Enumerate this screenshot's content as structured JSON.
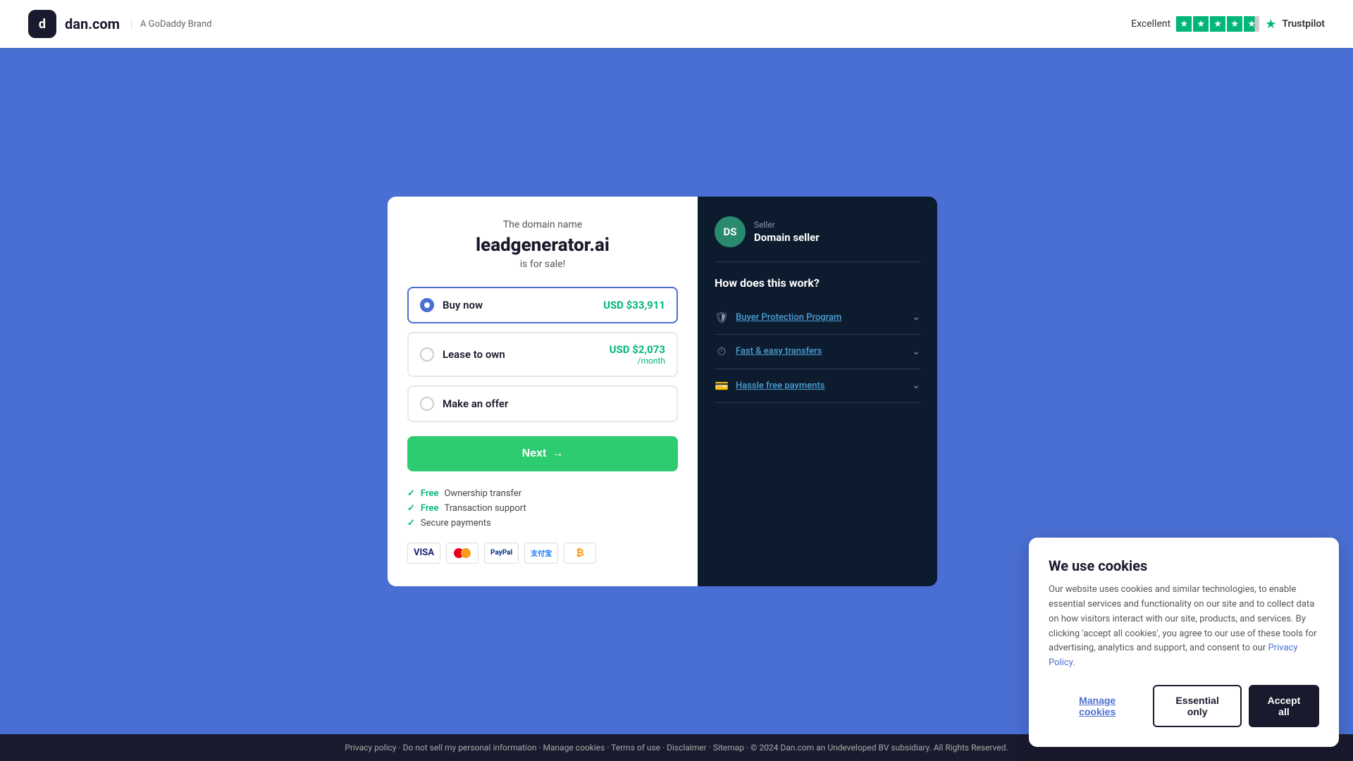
{
  "header": {
    "logo_text": "dan.com",
    "godaddy_brand": "A GoDaddy Brand",
    "trustpilot_label": "Excellent",
    "trustpilot_logo": "Trustpilot"
  },
  "domain": {
    "label": "The domain name",
    "name": "leadgenerator.ai",
    "for_sale": "is for sale!"
  },
  "options": [
    {
      "id": "buy-now",
      "label": "Buy now",
      "price": "USD $33,911",
      "price_sub": "",
      "selected": true
    },
    {
      "id": "lease-to-own",
      "label": "Lease to own",
      "price": "USD $2,073",
      "price_sub": "/month",
      "selected": false
    },
    {
      "id": "make-offer",
      "label": "Make an offer",
      "price": "",
      "price_sub": "",
      "selected": false
    }
  ],
  "next_button": "Next",
  "features": [
    {
      "free": true,
      "text": "Ownership transfer",
      "free_label": "Free"
    },
    {
      "free": true,
      "text": "Transaction support",
      "free_label": "Free"
    },
    {
      "free": false,
      "text": "Secure payments",
      "free_label": ""
    }
  ],
  "payment_methods": [
    "VISA",
    "Mastercard",
    "PayPal",
    "Alipay",
    "Crypto"
  ],
  "seller": {
    "initials": "DS",
    "role": "Seller",
    "name": "Domain seller"
  },
  "how_works": {
    "title": "How does this work?",
    "items": [
      {
        "label": "Buyer Protection Program",
        "icon": "🛡"
      },
      {
        "label": "Fast & easy transfers",
        "icon": "⏱"
      },
      {
        "label": "Hassle free payments",
        "icon": "💳"
      }
    ]
  },
  "footer": {
    "text": "Privacy policy · Do not sell my personal information · Manage cookies · Terms of use · Disclaimer · Sitemap · © 2024 Dan.com an Undeveloped BV subsidiary. All Rights Reserved."
  },
  "cookie": {
    "title": "We use cookies",
    "body": "Our website uses cookies and similar technologies, to enable essential services and functionality on our site and to collect data on how visitors interact with our site, products, and services. By clicking 'accept all cookies', you agree to our use of these tools for advertising, analytics and support, and consent to our",
    "privacy_link": "Privacy Policy.",
    "manage_label": "Manage cookies",
    "essential_label": "Essential only",
    "accept_label": "Accept all"
  }
}
